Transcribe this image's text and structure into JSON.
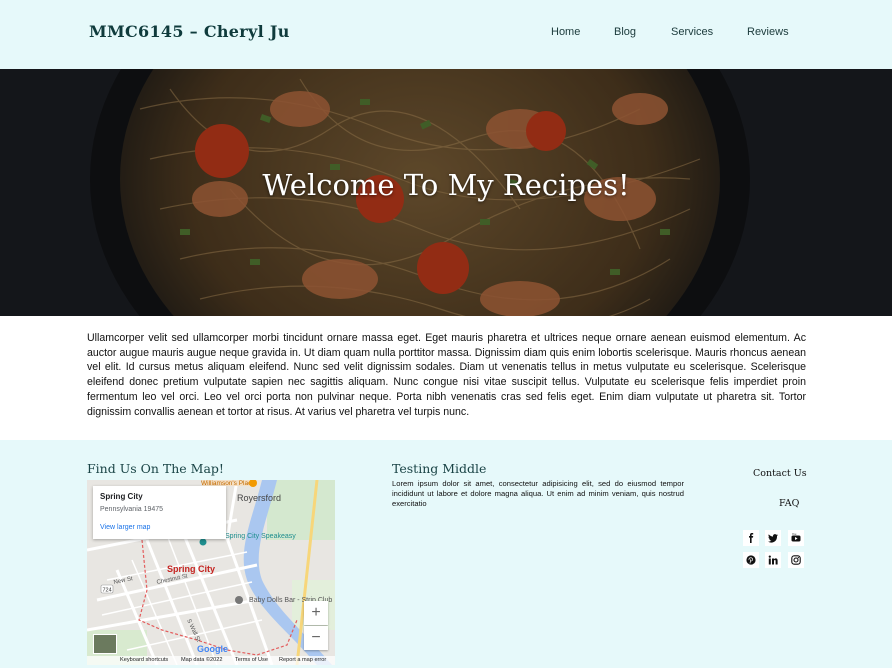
{
  "header": {
    "site_title": "MMC6145 – Cheryl Ju",
    "nav": [
      "Home",
      "Blog",
      "Services",
      "Reviews"
    ]
  },
  "hero": {
    "heading": "Welcome To My Recipes!"
  },
  "intro": {
    "paragraph": "Ullamcorper velit sed ullamcorper morbi tincidunt ornare massa eget. Eget mauris pharetra et ultrices neque ornare aenean euismod elementum. Ac auctor augue mauris augue neque gravida in. Ut diam quam nulla porttitor massa. Dignissim diam quis enim lobortis scelerisque. Mauris rhoncus aenean vel elit. Id cursus metus aliquam eleifend. Nunc sed velit dignissim sodales. Diam ut venenatis tellus in metus vulputate eu scelerisque. Scelerisque eleifend donec pretium vulputate sapien nec sagittis aliquam. Nunc congue nisi vitae suscipit tellus. Vulputate eu scelerisque felis imperdiet proin fermentum leo vel orci. Leo vel orci porta non pulvinar neque. Porta nibh venenatis cras sed felis eget. Enim diam vulputate ut pharetra sit. Tortor dignissim convallis aenean et tortor at risus. At varius vel pharetra vel turpis nunc."
  },
  "footer": {
    "map_title": "Find Us On The Map!",
    "middle_title": "Testing Middle",
    "middle_text": "Lorem ipsum dolor sit amet, consectetur adipisicing elit, sed do eiusmod tempor incididunt ut labore et dolore magna aliqua. Ut enim ad minim veniam, quis nostrud exercitatio",
    "links": [
      "Contact Us",
      "FAQ"
    ],
    "social_icons": [
      "facebook-icon",
      "twitter-icon",
      "youtube-icon",
      "pinterest-icon",
      "linkedin-icon",
      "instagram-icon"
    ]
  },
  "map": {
    "card_city": "Spring City",
    "card_state": "Pennsylvania 19475",
    "card_link": "View larger map",
    "labels": {
      "royersford": "Royersford",
      "spring_city": "Spring City",
      "speakeasy": "em - Spring City Speakeasy",
      "baby_dolls": "Baby Dolls Bar - Strip Club",
      "new_st": "New St",
      "chestnut": "Chestnut St",
      "s_wall": "S Wall St",
      "williamsons": "Williamson's Place",
      "route": "724"
    },
    "google": "Google",
    "bottom": [
      "Keyboard shortcuts",
      "Map data ©2022",
      "Terms of Use",
      "Report a map error"
    ],
    "zoom_in": "+",
    "zoom_out": "−"
  },
  "colors": {
    "header_bg": "#e6f9fa",
    "footer_bg": "#e6f9fa",
    "title_color": "#0f3b3c",
    "heading_color": "#1a4446"
  }
}
